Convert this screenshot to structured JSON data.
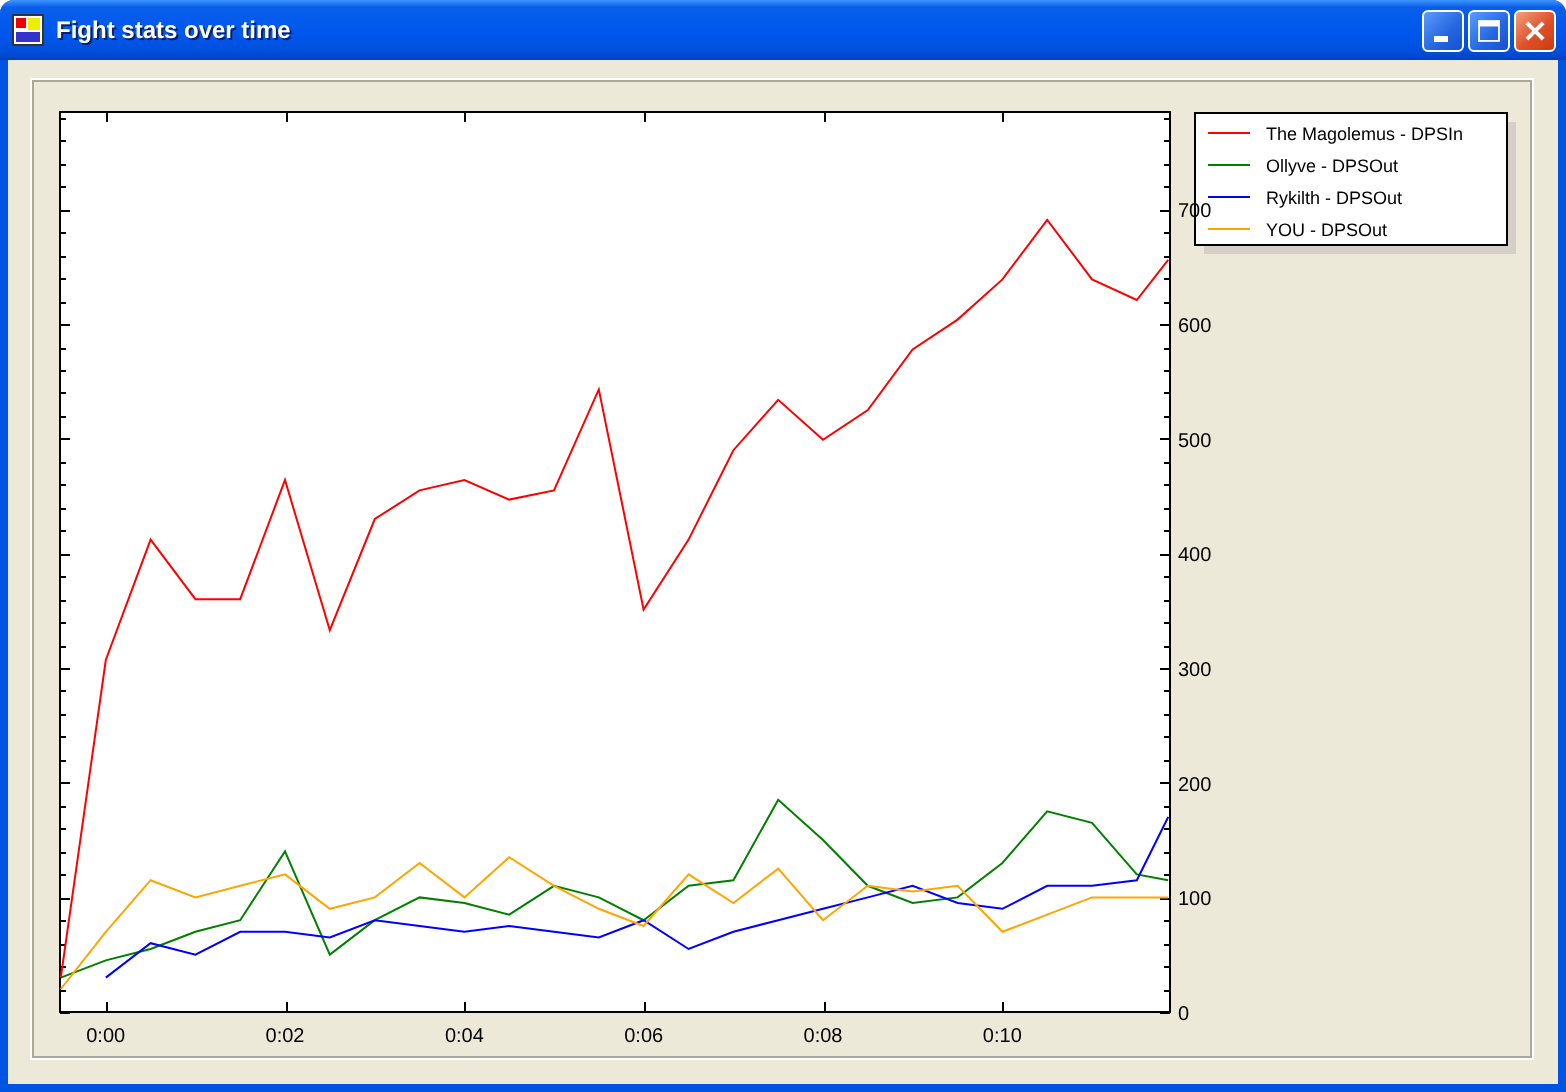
{
  "window": {
    "title": "Fight stats over time"
  },
  "chart": {
    "chart_data": {
      "type": "line",
      "x": [
        -0.5,
        0,
        0.5,
        1,
        1.5,
        2,
        2.5,
        3,
        3.5,
        4,
        4.5,
        5,
        5.5,
        6,
        6.5,
        7,
        7.5,
        8,
        8.5,
        9,
        9.5,
        10,
        10.5,
        11,
        11.5,
        11.85
      ],
      "series": [
        {
          "name": "The Magolemus - DPSIn",
          "color": "#ff0000",
          "values": [
            30,
            307,
            412,
            360,
            360,
            464,
            333,
            430,
            455,
            464,
            447,
            455,
            543,
            351,
            412,
            490,
            534,
            499,
            525,
            578,
            604,
            639,
            691,
            639,
            621,
            656
          ]
        },
        {
          "name": "Ollyve - DPSOut",
          "color": "#008000",
          "values": [
            30,
            45,
            55,
            70,
            80,
            140,
            50,
            80,
            100,
            95,
            85,
            110,
            100,
            80,
            110,
            115,
            185,
            150,
            110,
            95,
            100,
            130,
            175,
            165,
            120,
            115
          ]
        },
        {
          "name": "Rykilth - DPSOut",
          "color": "#0000ff",
          "values": [
            null,
            30,
            60,
            50,
            70,
            70,
            65,
            80,
            75,
            70,
            75,
            70,
            65,
            80,
            55,
            70,
            80,
            90,
            100,
            110,
            95,
            90,
            110,
            110,
            115,
            170
          ]
        },
        {
          "name": "YOU - DPSOut",
          "color": "#ffa500",
          "values": [
            20,
            70,
            115,
            100,
            110,
            120,
            90,
            100,
            130,
            100,
            135,
            110,
            90,
            75,
            120,
            95,
            125,
            80,
            110,
            105,
            110,
            70,
            85,
            100,
            100,
            100
          ]
        }
      ],
      "xlim": [
        -0.51,
        11.87
      ],
      "ylim": [
        0,
        785
      ],
      "xticks": [
        {
          "value": 0,
          "label": "0:00"
        },
        {
          "value": 2,
          "label": "0:02"
        },
        {
          "value": 4,
          "label": "0:04"
        },
        {
          "value": 6,
          "label": "0:06"
        },
        {
          "value": 8,
          "label": "0:08"
        },
        {
          "value": 10,
          "label": "0:10"
        }
      ],
      "yticks": [
        0,
        100,
        200,
        300,
        400,
        500,
        600,
        700
      ],
      "legend": "upper right, outside"
    }
  }
}
